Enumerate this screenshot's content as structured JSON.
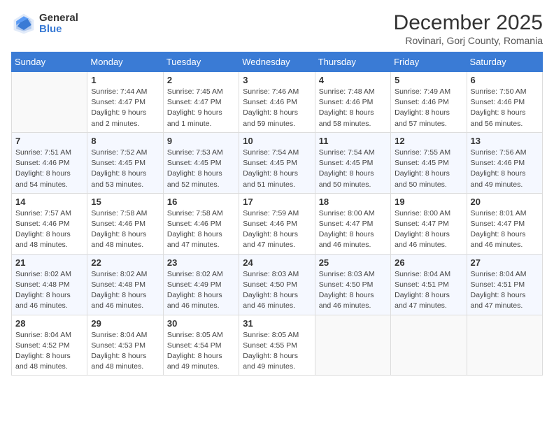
{
  "logo": {
    "general": "General",
    "blue": "Blue"
  },
  "title": {
    "month_year": "December 2025",
    "location": "Rovinari, Gorj County, Romania"
  },
  "days_of_week": [
    "Sunday",
    "Monday",
    "Tuesday",
    "Wednesday",
    "Thursday",
    "Friday",
    "Saturday"
  ],
  "weeks": [
    [
      {
        "day": "",
        "sunrise": "",
        "sunset": "",
        "daylight": ""
      },
      {
        "day": "1",
        "sunrise": "Sunrise: 7:44 AM",
        "sunset": "Sunset: 4:47 PM",
        "daylight": "Daylight: 9 hours and 2 minutes."
      },
      {
        "day": "2",
        "sunrise": "Sunrise: 7:45 AM",
        "sunset": "Sunset: 4:47 PM",
        "daylight": "Daylight: 9 hours and 1 minute."
      },
      {
        "day": "3",
        "sunrise": "Sunrise: 7:46 AM",
        "sunset": "Sunset: 4:46 PM",
        "daylight": "Daylight: 8 hours and 59 minutes."
      },
      {
        "day": "4",
        "sunrise": "Sunrise: 7:48 AM",
        "sunset": "Sunset: 4:46 PM",
        "daylight": "Daylight: 8 hours and 58 minutes."
      },
      {
        "day": "5",
        "sunrise": "Sunrise: 7:49 AM",
        "sunset": "Sunset: 4:46 PM",
        "daylight": "Daylight: 8 hours and 57 minutes."
      },
      {
        "day": "6",
        "sunrise": "Sunrise: 7:50 AM",
        "sunset": "Sunset: 4:46 PM",
        "daylight": "Daylight: 8 hours and 56 minutes."
      }
    ],
    [
      {
        "day": "7",
        "sunrise": "Sunrise: 7:51 AM",
        "sunset": "Sunset: 4:46 PM",
        "daylight": "Daylight: 8 hours and 54 minutes."
      },
      {
        "day": "8",
        "sunrise": "Sunrise: 7:52 AM",
        "sunset": "Sunset: 4:45 PM",
        "daylight": "Daylight: 8 hours and 53 minutes."
      },
      {
        "day": "9",
        "sunrise": "Sunrise: 7:53 AM",
        "sunset": "Sunset: 4:45 PM",
        "daylight": "Daylight: 8 hours and 52 minutes."
      },
      {
        "day": "10",
        "sunrise": "Sunrise: 7:54 AM",
        "sunset": "Sunset: 4:45 PM",
        "daylight": "Daylight: 8 hours and 51 minutes."
      },
      {
        "day": "11",
        "sunrise": "Sunrise: 7:54 AM",
        "sunset": "Sunset: 4:45 PM",
        "daylight": "Daylight: 8 hours and 50 minutes."
      },
      {
        "day": "12",
        "sunrise": "Sunrise: 7:55 AM",
        "sunset": "Sunset: 4:45 PM",
        "daylight": "Daylight: 8 hours and 50 minutes."
      },
      {
        "day": "13",
        "sunrise": "Sunrise: 7:56 AM",
        "sunset": "Sunset: 4:46 PM",
        "daylight": "Daylight: 8 hours and 49 minutes."
      }
    ],
    [
      {
        "day": "14",
        "sunrise": "Sunrise: 7:57 AM",
        "sunset": "Sunset: 4:46 PM",
        "daylight": "Daylight: 8 hours and 48 minutes."
      },
      {
        "day": "15",
        "sunrise": "Sunrise: 7:58 AM",
        "sunset": "Sunset: 4:46 PM",
        "daylight": "Daylight: 8 hours and 48 minutes."
      },
      {
        "day": "16",
        "sunrise": "Sunrise: 7:58 AM",
        "sunset": "Sunset: 4:46 PM",
        "daylight": "Daylight: 8 hours and 47 minutes."
      },
      {
        "day": "17",
        "sunrise": "Sunrise: 7:59 AM",
        "sunset": "Sunset: 4:46 PM",
        "daylight": "Daylight: 8 hours and 47 minutes."
      },
      {
        "day": "18",
        "sunrise": "Sunrise: 8:00 AM",
        "sunset": "Sunset: 4:47 PM",
        "daylight": "Daylight: 8 hours and 46 minutes."
      },
      {
        "day": "19",
        "sunrise": "Sunrise: 8:00 AM",
        "sunset": "Sunset: 4:47 PM",
        "daylight": "Daylight: 8 hours and 46 minutes."
      },
      {
        "day": "20",
        "sunrise": "Sunrise: 8:01 AM",
        "sunset": "Sunset: 4:47 PM",
        "daylight": "Daylight: 8 hours and 46 minutes."
      }
    ],
    [
      {
        "day": "21",
        "sunrise": "Sunrise: 8:02 AM",
        "sunset": "Sunset: 4:48 PM",
        "daylight": "Daylight: 8 hours and 46 minutes."
      },
      {
        "day": "22",
        "sunrise": "Sunrise: 8:02 AM",
        "sunset": "Sunset: 4:48 PM",
        "daylight": "Daylight: 8 hours and 46 minutes."
      },
      {
        "day": "23",
        "sunrise": "Sunrise: 8:02 AM",
        "sunset": "Sunset: 4:49 PM",
        "daylight": "Daylight: 8 hours and 46 minutes."
      },
      {
        "day": "24",
        "sunrise": "Sunrise: 8:03 AM",
        "sunset": "Sunset: 4:50 PM",
        "daylight": "Daylight: 8 hours and 46 minutes."
      },
      {
        "day": "25",
        "sunrise": "Sunrise: 8:03 AM",
        "sunset": "Sunset: 4:50 PM",
        "daylight": "Daylight: 8 hours and 46 minutes."
      },
      {
        "day": "26",
        "sunrise": "Sunrise: 8:04 AM",
        "sunset": "Sunset: 4:51 PM",
        "daylight": "Daylight: 8 hours and 47 minutes."
      },
      {
        "day": "27",
        "sunrise": "Sunrise: 8:04 AM",
        "sunset": "Sunset: 4:51 PM",
        "daylight": "Daylight: 8 hours and 47 minutes."
      }
    ],
    [
      {
        "day": "28",
        "sunrise": "Sunrise: 8:04 AM",
        "sunset": "Sunset: 4:52 PM",
        "daylight": "Daylight: 8 hours and 48 minutes."
      },
      {
        "day": "29",
        "sunrise": "Sunrise: 8:04 AM",
        "sunset": "Sunset: 4:53 PM",
        "daylight": "Daylight: 8 hours and 48 minutes."
      },
      {
        "day": "30",
        "sunrise": "Sunrise: 8:05 AM",
        "sunset": "Sunset: 4:54 PM",
        "daylight": "Daylight: 8 hours and 49 minutes."
      },
      {
        "day": "31",
        "sunrise": "Sunrise: 8:05 AM",
        "sunset": "Sunset: 4:55 PM",
        "daylight": "Daylight: 8 hours and 49 minutes."
      },
      {
        "day": "",
        "sunrise": "",
        "sunset": "",
        "daylight": ""
      },
      {
        "day": "",
        "sunrise": "",
        "sunset": "",
        "daylight": ""
      },
      {
        "day": "",
        "sunrise": "",
        "sunset": "",
        "daylight": ""
      }
    ]
  ]
}
